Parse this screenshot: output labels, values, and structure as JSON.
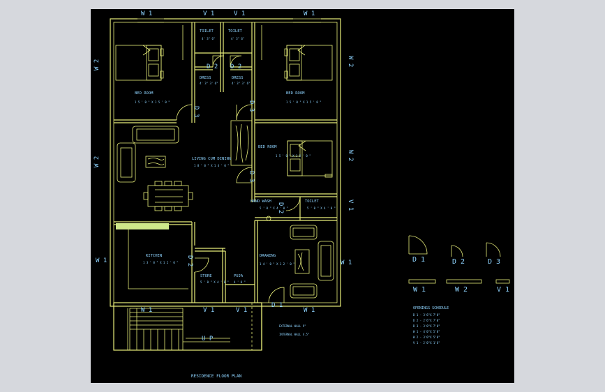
{
  "colors": {
    "background": "#000000",
    "wall": "#e8ee7a",
    "text": "#8fd4ff",
    "highlight": "#cfe88a"
  },
  "plan": {
    "title": "RESIDENCE FLOOR PLAN",
    "rooms": {
      "bed_left": {
        "name": "BED ROOM",
        "size": "1 5 ' 0 \" X 1 5 ' 0 \""
      },
      "bed_right": {
        "name": "BED ROOM",
        "size": "1 5 ' 0 \" X 1 5 ' 0 \""
      },
      "bed_mid": {
        "name": "BED ROOM",
        "size": "1 5 ' 0 \" X 1 5 ' 0 \""
      },
      "toilet_a": {
        "name": "TOILET",
        "size": "4' 3\" 6\""
      },
      "toilet_b": {
        "name": "TOILET",
        "size": "4' 3\" 6\""
      },
      "dress_a": {
        "name": "DRESS",
        "size": "4' 3\" 3' 6\""
      },
      "dress_b": {
        "name": "DRESS",
        "size": "4' 3\" 3' 6\""
      },
      "living": {
        "name": "LIVING CUM DINING",
        "size": "1 8 ' 0 \" X 1 4 ' 0 \""
      },
      "hand_wash": {
        "name": "HAND WASH",
        "size": "5 ' 0 \" X 4 ' 0 \""
      },
      "toilet_c": {
        "name": "TOILET",
        "size": "5 ' 0 \" X 4 ' 0 \""
      },
      "kitchen": {
        "name": "KITCHEN",
        "size": "1 3 ' 0 \" X 1 2 ' 0 \""
      },
      "store": {
        "name": "STORE",
        "size": "5 ' 0 \" X 4 ' 0 \""
      },
      "puja": {
        "name": "PUJA",
        "size": "4 ' 0 \""
      },
      "drawing": {
        "name": "DRAWING",
        "size": "1 4 ' 0 \" X 1 2 ' 0 \""
      }
    },
    "tags": {
      "W1": "W 1",
      "W2": "W 2",
      "V1": "V 1",
      "D1": "D 1",
      "D2": "D 2",
      "D3": "D 3",
      "UP": "U P"
    },
    "wall_notes": [
      "EXTERNAL WALL 9\"",
      "INTERNAL WALL 4.5\""
    ]
  },
  "legend": {
    "doors": [
      "D 1",
      "D 2",
      "D 3"
    ],
    "windows": [
      "W 1",
      "W 2",
      "V 1"
    ],
    "schedule_title": "OPENINGS SCHEDULE",
    "schedule_rows": [
      "D 1 - 3'6\"X 7'0\"",
      "D 2 - 2'6\"X 7'0\"",
      "D 3 - 3'0\"X 7'0\"",
      "W 1 - 4'0\"X 5'0\"",
      "W 2 - 3'0\"X 5'0\"",
      "V 1 - 2'0\"X 1'6\""
    ]
  }
}
